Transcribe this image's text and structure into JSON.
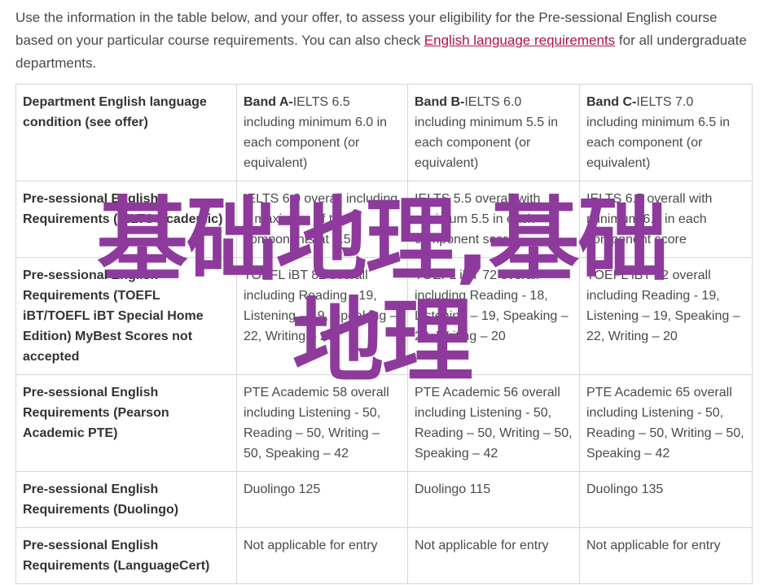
{
  "intro": {
    "text_before": "Use the information in the table below, and your offer, to assess your eligibility for the Pre-sessional English course based on your particular course requirements. You can also check ",
    "link_text": "English language requirements",
    "text_after": " for all undergraduate departments."
  },
  "table": {
    "header_row": {
      "label": "Department English language condition (see offer)",
      "bands": [
        {
          "band": "Band A-",
          "text": "IELTS 6.5 including minimum 6.0 in each component (or equivalent)"
        },
        {
          "band": "Band B-",
          "text": "IELTS 6.0 including minimum 5.5 in each component (or equivalent)"
        },
        {
          "band": "Band C-",
          "text": "IELTS 7.0 including minimum 6.5 in each component (or equivalent)"
        }
      ]
    },
    "rows": [
      {
        "label": "Pre-sessional English Requirements (IELTS Academic)",
        "cells": [
          "IELTS 6.0 overall including a maximum of two components at 5.5",
          "IELTS 5.5 overall with minimum 5.5 in each component score",
          "IELTS 6.5 overall with minimum 6.0 in each component score"
        ]
      },
      {
        "label": "Pre-sessional English Requirements (TOEFL iBT/TOEFL iBT Special Home Edition) MyBest Scores not accepted",
        "cells": [
          "TOEFL iBT 82 overall including Reading - 19, Listening – 19, Speaking – 22, Writing – 20",
          "TOEFL iBT 72 overall including Reading - 18, Listening – 19, Speaking – 20, Writing – 20",
          "TOEFL iBT 92 overall including Reading - 19, Listening – 19, Speaking – 22, Writing – 20"
        ]
      },
      {
        "label": "Pre-sessional English Requirements (Pearson Academic PTE)",
        "cells": [
          "PTE Academic 58 overall including Listening - 50, Reading – 50, Writing – 50, Speaking – 42",
          "PTE Academic 56 overall including Listening - 50, Reading – 50, Writing – 50, Speaking – 42",
          "PTE Academic 65 overall including Listening - 50, Reading – 50, Writing – 50, Speaking – 42"
        ]
      },
      {
        "label": "Pre-sessional English Requirements (Duolingo)",
        "cells": [
          "Duolingo 125",
          "Duolingo 115",
          "Duolingo 135"
        ]
      },
      {
        "label": "Pre-sessional English Requirements (LanguageCert)",
        "cells": [
          "Not applicable for entry",
          "Not applicable for entry",
          "Not applicable for entry"
        ]
      }
    ]
  },
  "watermark": {
    "line1": "基础地理,基础",
    "line2": "地理"
  },
  "colors": {
    "link": "#b3124a",
    "watermark": "#8e3a9c",
    "border": "#d6d6d6",
    "text": "#4a4a4a"
  }
}
